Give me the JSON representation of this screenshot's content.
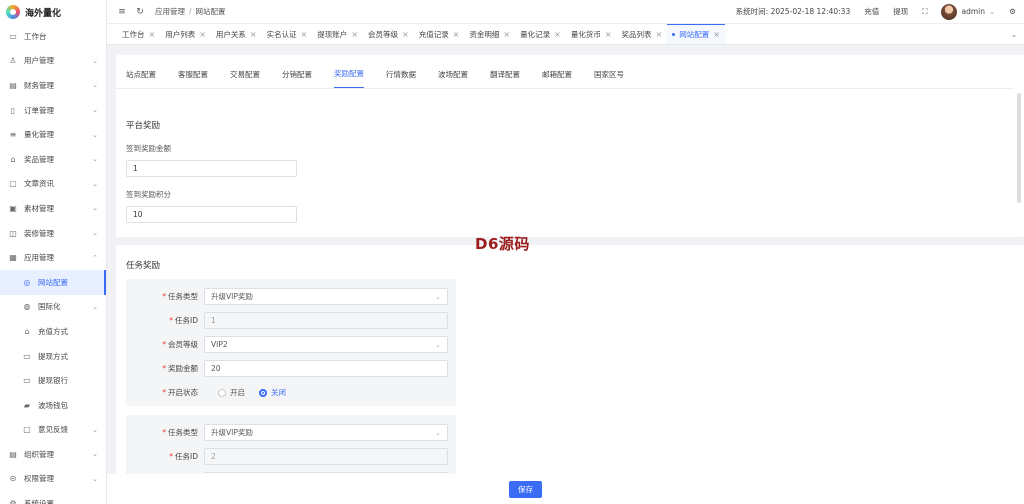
{
  "app": {
    "name": "海外量化"
  },
  "sidebar": {
    "items": [
      {
        "label": "工作台",
        "icon": "monitor-icon",
        "glyph": "▭",
        "chevron": false
      },
      {
        "label": "用户管理",
        "icon": "user-icon",
        "glyph": "♙",
        "chevron": true
      },
      {
        "label": "财务管理",
        "icon": "chart-icon",
        "glyph": "▤",
        "chevron": true
      },
      {
        "label": "订单管理",
        "icon": "document-icon",
        "glyph": "▯",
        "chevron": true
      },
      {
        "label": "量化管理",
        "icon": "layers-icon",
        "glyph": "≡",
        "chevron": true
      },
      {
        "label": "奖品管理",
        "icon": "gift-icon",
        "glyph": "⌂",
        "chevron": true
      },
      {
        "label": "文章资讯",
        "icon": "message-icon",
        "glyph": "▢",
        "chevron": true
      },
      {
        "label": "素材管理",
        "icon": "image-icon",
        "glyph": "▣",
        "chevron": true
      },
      {
        "label": "装修管理",
        "icon": "brush-icon",
        "glyph": "◫",
        "chevron": true
      },
      {
        "label": "应用管理",
        "icon": "app-icon",
        "glyph": "▦",
        "chevron": true,
        "expanded": true
      },
      {
        "label": "网站配置",
        "icon": "globe-icon",
        "glyph": "◎",
        "sub": true,
        "active": true
      },
      {
        "label": "国际化",
        "icon": "language-icon",
        "glyph": "◍",
        "sub": true,
        "chevron": true
      },
      {
        "label": "充值方式",
        "icon": "wallet-icon",
        "glyph": "⌂",
        "sub": true
      },
      {
        "label": "提现方式",
        "icon": "folder-icon",
        "glyph": "▭",
        "sub": true
      },
      {
        "label": "提现银行",
        "icon": "bank-card-icon",
        "glyph": "▭",
        "sub": true
      },
      {
        "label": "波场钱包",
        "icon": "wallet-icon",
        "glyph": "▰",
        "sub": true
      },
      {
        "label": "意见反馈",
        "icon": "feedback-icon",
        "glyph": "▢",
        "sub": true,
        "chevron": true
      },
      {
        "label": "组织管理",
        "icon": "org-icon",
        "glyph": "▤",
        "chevron": true
      },
      {
        "label": "权限管理",
        "icon": "lock-icon",
        "glyph": "⊝",
        "chevron": true
      },
      {
        "label": "系统设置",
        "icon": "settings-icon",
        "glyph": "⚙",
        "chevron": true
      }
    ]
  },
  "header": {
    "menu_icon": "≡",
    "refresh_icon": "↻",
    "breadcrumb": [
      "应用管理",
      "网站配置"
    ],
    "system_time_label": "系统时间:",
    "system_time": "2025-02-18 12:40:33",
    "recharge": "充值",
    "withdraw": "提现",
    "user": "admin"
  },
  "tabs": [
    {
      "label": "工作台"
    },
    {
      "label": "用户列表"
    },
    {
      "label": "用户关系"
    },
    {
      "label": "实名认证"
    },
    {
      "label": "提现账户"
    },
    {
      "label": "会员等级"
    },
    {
      "label": "充值记录"
    },
    {
      "label": "资金明细"
    },
    {
      "label": "量化记录"
    },
    {
      "label": "量化货币"
    },
    {
      "label": "奖品列表"
    },
    {
      "label": "网站配置",
      "active": true
    }
  ],
  "subtabs": [
    {
      "label": "站点配置"
    },
    {
      "label": "客服配置"
    },
    {
      "label": "交易配置"
    },
    {
      "label": "分销配置"
    },
    {
      "label": "奖励配置",
      "active": true
    },
    {
      "label": "行情数据"
    },
    {
      "label": "波场配置"
    },
    {
      "label": "翻译配置"
    },
    {
      "label": "邮箱配置"
    },
    {
      "label": "国家区号"
    }
  ],
  "platform": {
    "title": "平台奖励",
    "checkin_amount_label": "签到奖励金额",
    "checkin_amount": "1",
    "checkin_points_label": "签到奖励积分",
    "checkin_points": "10"
  },
  "tasks": {
    "title": "任务奖励",
    "labels": {
      "type": "任务类型",
      "id": "任务ID",
      "level": "会员等级",
      "amount": "奖励金额",
      "status": "开启状态",
      "on": "开启",
      "off": "关闭"
    },
    "items": [
      {
        "type": "升级VIP奖励",
        "id": "1",
        "level": "VIP2",
        "amount": "20",
        "status": "off"
      },
      {
        "type": "升级VIP奖励",
        "id": "2"
      }
    ]
  },
  "watermark": "D6源码",
  "footer": {
    "save": "保存"
  },
  "colors": {
    "accent": "#3b6cf6",
    "required": "#ee3333",
    "watermark": "#9b1c1c"
  }
}
